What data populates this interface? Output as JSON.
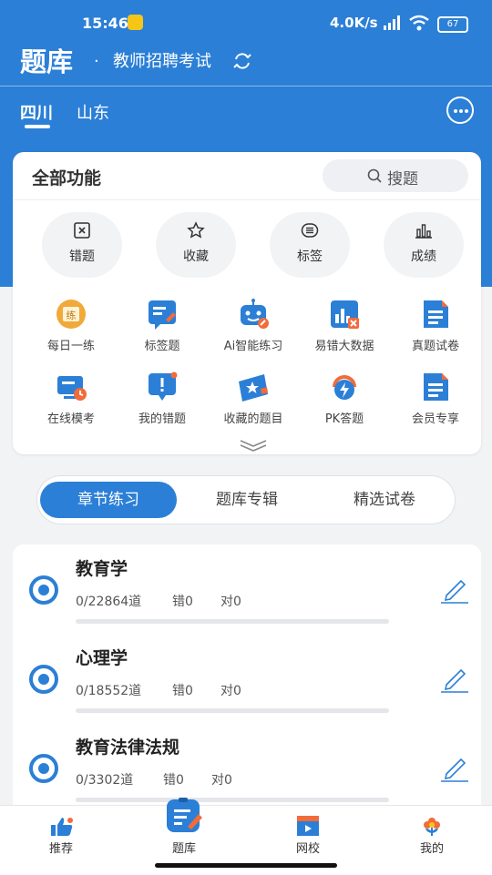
{
  "status_bar": {
    "time": "15:46",
    "net_speed": "4.0K/s",
    "battery": "67"
  },
  "header": {
    "title": "题库",
    "separator": "·",
    "exam": "教师招聘考试"
  },
  "region_tabs": [
    {
      "label": "四川",
      "active": true
    },
    {
      "label": "山东",
      "active": false
    }
  ],
  "functions": {
    "title": "全部功能",
    "search_label": "搜题",
    "quick": [
      {
        "label": "错题",
        "icon": "wrong-book-icon"
      },
      {
        "label": "收藏",
        "icon": "star-icon"
      },
      {
        "label": "标签",
        "icon": "tag-list-icon"
      },
      {
        "label": "成绩",
        "icon": "bar-chart-icon"
      }
    ],
    "grid": [
      {
        "label": "每日一练",
        "icon": "daily-practice-icon",
        "badge": "练"
      },
      {
        "label": "标签题",
        "icon": "tag-question-icon"
      },
      {
        "label": "Ai智能练习",
        "icon": "ai-robot-icon"
      },
      {
        "label": "易错大数据",
        "icon": "error-data-icon"
      },
      {
        "label": "真题试卷",
        "icon": "exam-paper-icon"
      },
      {
        "label": "在线模考",
        "icon": "online-exam-icon"
      },
      {
        "label": "我的错题",
        "icon": "my-wrong-icon"
      },
      {
        "label": "收藏的题目",
        "icon": "favorite-ticket-icon"
      },
      {
        "label": "PK答题",
        "icon": "pk-icon"
      },
      {
        "label": "会员专享",
        "icon": "vip-doc-icon"
      }
    ]
  },
  "segments": [
    {
      "label": "章节练习",
      "active": true
    },
    {
      "label": "题库专辑",
      "active": false
    },
    {
      "label": "精选试卷",
      "active": false
    }
  ],
  "subjects": [
    {
      "title": "教育学",
      "progress": "0/22864道",
      "wrong": "错0",
      "right": "对0",
      "progress_fraction": 0
    },
    {
      "title": "心理学",
      "progress": "0/18552道",
      "wrong": "错0",
      "right": "对0",
      "progress_fraction": 0
    },
    {
      "title": "教育法律法规",
      "progress": "0/3302道",
      "wrong": "错0",
      "right": "对0",
      "progress_fraction": 0
    }
  ],
  "bottom_nav": [
    {
      "label": "推荐",
      "icon": "thumbs-up-icon"
    },
    {
      "label": "题库",
      "icon": "question-bank-icon",
      "active": true
    },
    {
      "label": "网校",
      "icon": "video-school-icon"
    },
    {
      "label": "我的",
      "icon": "flower-profile-icon"
    }
  ],
  "colors": {
    "primary": "#2b7fd6",
    "background": "#f2f3f5"
  }
}
